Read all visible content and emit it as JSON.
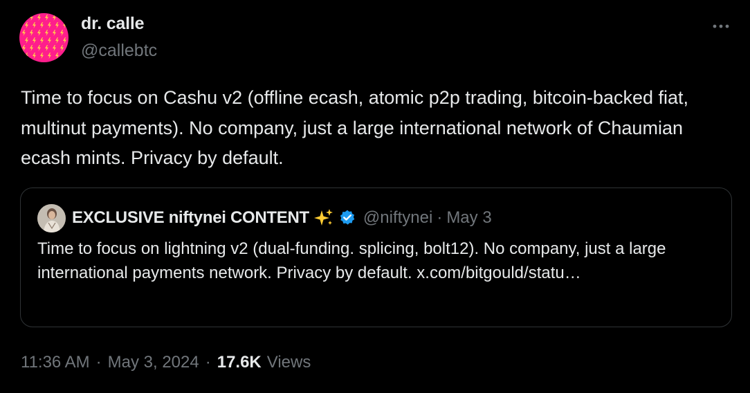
{
  "tweet": {
    "author": {
      "name": "dr. calle",
      "handle": "@callebtc",
      "avatar_color": "#ff1e8c",
      "avatar_glyph_color": "#ffd24a"
    },
    "more_icon": "more-horizontal-icon",
    "body": "Time to focus on Cashu v2 (offline ecash, atomic p2p trading, bitcoin-backed fiat, multinut payments). No company, just a large international network of Chaumian ecash mints. Privacy by default.",
    "quote": {
      "author": {
        "name": "EXCLUSIVE niftynei CONTENT",
        "handle": "@niftynei",
        "sparkle_icon": "sparkles-icon",
        "verified_icon": "verified-badge-icon",
        "verified_color": "#1d9bf0"
      },
      "separator": "·",
      "date": "May 3",
      "body": "Time to focus on lightning v2 (dual-funding. splicing, bolt12). No company, just a large international payments network. Privacy by default. x.com/bitgould/statu…"
    },
    "meta": {
      "time": "11:36 AM",
      "separator": "·",
      "date": "May 3, 2024",
      "views_count": "17.6K",
      "views_label": "Views"
    }
  }
}
